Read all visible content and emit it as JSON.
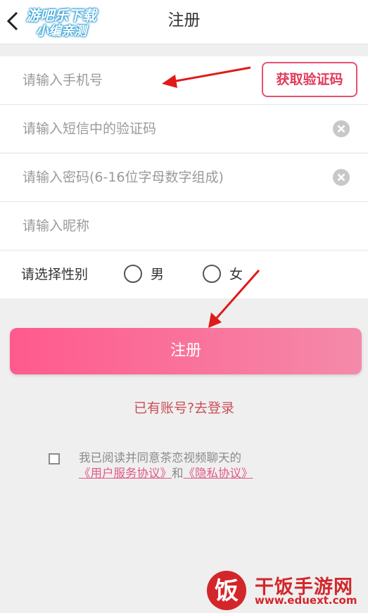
{
  "header": {
    "title": "注册"
  },
  "watermark_top": {
    "line1": "游吧乐下载",
    "line2": "小编亲测"
  },
  "form": {
    "phone_placeholder": "请输入手机号",
    "get_code_label": "获取验证码",
    "sms_code_placeholder": "请输入短信中的验证码",
    "password_placeholder": "请输入密码(6-16位字母数字组成)",
    "nickname_placeholder": "请输入昵称",
    "gender_label": "请选择性别",
    "gender_options": [
      "男",
      "女"
    ]
  },
  "register_label": "注册",
  "login_link": "已有账号?去登录",
  "agreement": {
    "prefix": "我已阅读并同意茶恋视频聊天的",
    "user_service": "《用户服务协议》",
    "conjunction": "和",
    "privacy": "《隐私协议》"
  },
  "watermark_bottom": {
    "logo_char": "饭",
    "brand": "干饭手游网",
    "url": "www.eduext.com"
  },
  "colors": {
    "accent": "#e8506f",
    "link": "#c94f57",
    "button_start": "#ff5a8d",
    "button_end": "#f48aaa",
    "arrow": "#e01a1a"
  }
}
